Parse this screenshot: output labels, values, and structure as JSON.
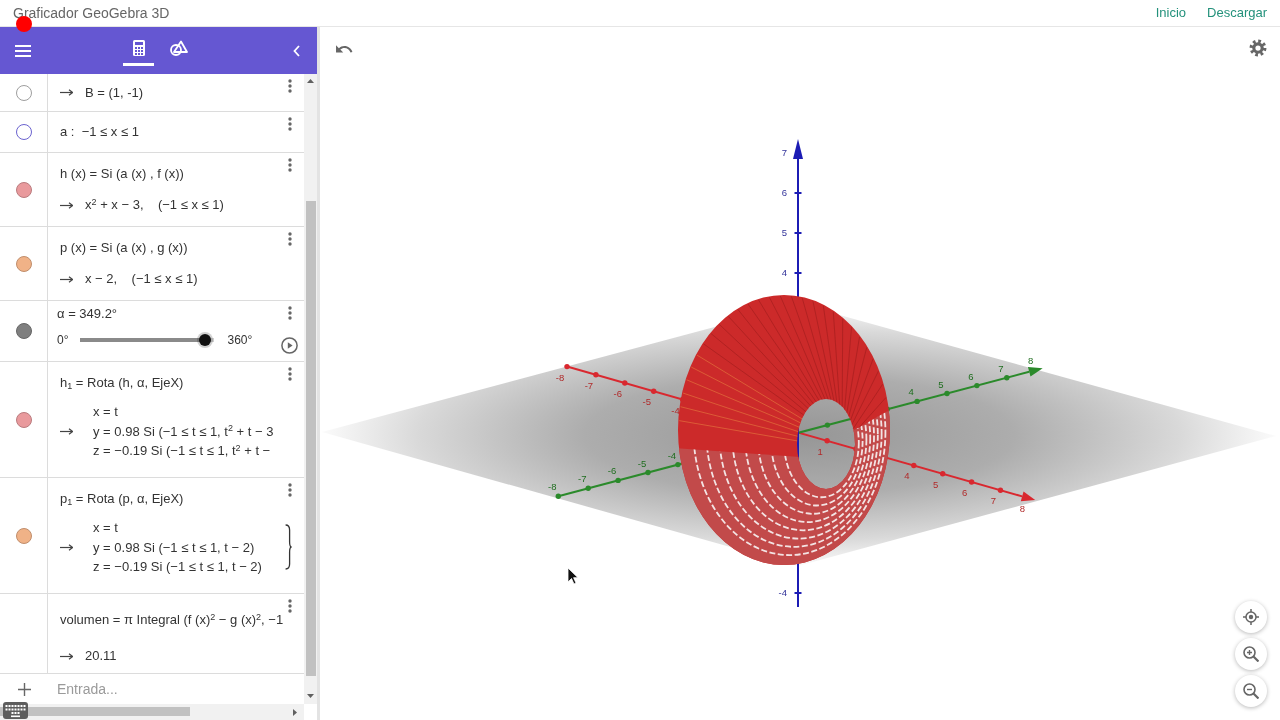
{
  "header": {
    "title": "Graficador GeoGebra 3D",
    "links": [
      {
        "label": "Inicio"
      },
      {
        "label": "Descargar"
      }
    ]
  },
  "toolbar": {
    "tabs": [
      {
        "kind": "algebra",
        "selected": true
      },
      {
        "kind": "tools",
        "selected": false
      }
    ]
  },
  "algebra": {
    "items": [
      {
        "kind": "output",
        "marker": {
          "visible": false,
          "color": "#9e9e9e"
        },
        "output": "B = (1, -1)"
      },
      {
        "kind": "definition",
        "marker": {
          "visible": false,
          "color": "#6b63cf"
        },
        "definition": "a :  −1 ≤ x ≤ 1"
      },
      {
        "kind": "function",
        "marker": {
          "visible": true,
          "color": "#e99a9d"
        },
        "definition": "h (x) = Si (a (x) , f (x))",
        "output": "x$^{2}$ + x − 3,    (−1 ≤ x ≤ 1)"
      },
      {
        "kind": "function",
        "marker": {
          "visible": true,
          "color": "#f0b287"
        },
        "definition": "p (x) = Si (a (x) , g (x))",
        "output": "x − 2,    (−1 ≤ x ≤ 1)"
      },
      {
        "kind": "slider",
        "marker": {
          "visible": true,
          "color": "#7f7f7f"
        },
        "definition": "α = 349.2°",
        "min_label": "0°",
        "max_label": "360°",
        "level": 0.97
      },
      {
        "kind": "curve",
        "marker": {
          "visible": true,
          "color": "#e99a9d"
        },
        "definition": "h$_{1}$ = Rota (h, α, EjeX)",
        "output_lines": [
          "x = t",
          "y = 0.98 Si (−1 ≤ t ≤ 1, t$^{2}$ + t − 3",
          "z = −0.19 Si (−1 ≤ t ≤ 1, t$^{2}$ + t −"
        ],
        "brace": false
      },
      {
        "kind": "curve",
        "marker": {
          "visible": true,
          "color": "#f0b287"
        },
        "definition": "p$_{1}$ = Rota (p, α, EjeX)",
        "output_lines": [
          "x = t",
          "y = 0.98 Si (−1 ≤ t ≤ 1, t − 2)",
          "z = −0.19 Si (−1 ≤ t ≤ 1, t − 2)"
        ],
        "brace": true
      },
      {
        "kind": "value",
        "definition": "volumen = π Integral (f (x)$^{2}$ − g (x)$^{2}$, −1",
        "output": "20.11"
      }
    ],
    "input": {
      "placeholder": "Entrada..."
    }
  },
  "graphics": {
    "axes": [
      {
        "kind": "x",
        "ticks": [
          "-8",
          "-7",
          "-6",
          "-5",
          "-4",
          "1",
          "4",
          "5",
          "6",
          "7",
          "8"
        ]
      },
      {
        "kind": "y",
        "ticks": [
          "-8",
          "-7",
          "-6",
          "-5",
          "-4",
          "4",
          "5",
          "6",
          "7",
          "8"
        ]
      },
      {
        "kind": "z",
        "ticks": [
          "7",
          "6",
          "5",
          "4",
          "-4"
        ]
      }
    ]
  }
}
